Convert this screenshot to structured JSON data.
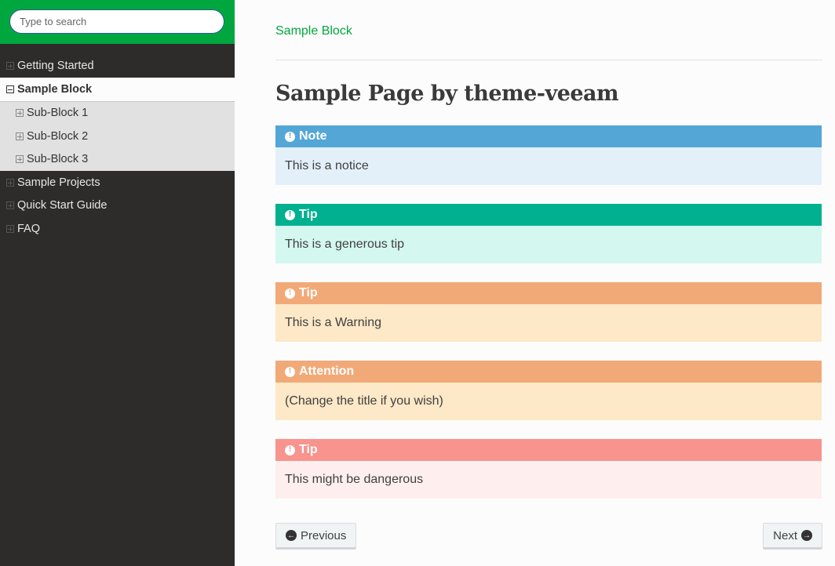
{
  "search": {
    "placeholder": "Type to search"
  },
  "sidebar": {
    "items": [
      {
        "label": "Getting Started",
        "state": "collapsed"
      },
      {
        "label": "Sample Block",
        "state": "expanded",
        "active": true,
        "children": [
          {
            "label": "Sub-Block 1"
          },
          {
            "label": "Sub-Block 2"
          },
          {
            "label": "Sub-Block 3"
          }
        ]
      },
      {
        "label": "Sample Projects",
        "state": "collapsed"
      },
      {
        "label": "Quick Start Guide",
        "state": "collapsed"
      },
      {
        "label": "FAQ",
        "state": "collapsed"
      }
    ]
  },
  "main": {
    "breadcrumb": "Sample Block",
    "title": "Sample Page by theme-veeam",
    "admonitions": [
      {
        "type": "note",
        "icon": "exclamation-circle-icon",
        "title": "Note",
        "body": "This is a notice",
        "color": "#54a6d6"
      },
      {
        "type": "tip",
        "icon": "exclamation-circle-icon",
        "title": "Tip",
        "body": "This is a generous tip",
        "color": "#00b08f"
      },
      {
        "type": "warning",
        "icon": "exclamation-circle-icon",
        "title": "Tip",
        "body": "This is a Warning",
        "color": "#f2a978"
      },
      {
        "type": "attention",
        "icon": "exclamation-circle-icon",
        "title": "Attention",
        "body": "(Change the title if you wish)",
        "color": "#f2a978"
      },
      {
        "type": "danger",
        "icon": "exclamation-circle-icon",
        "title": "Tip",
        "body": "This might be dangerous",
        "color": "#f8938d"
      }
    ],
    "nav": {
      "previous_label": "Previous",
      "next_label": "Next",
      "previous_icon": "arrow-circle-left-icon",
      "next_icon": "arrow-circle-right-icon"
    }
  },
  "colors": {
    "brand": "#00a73f",
    "sidebar_bg": "#2d2c2a"
  }
}
